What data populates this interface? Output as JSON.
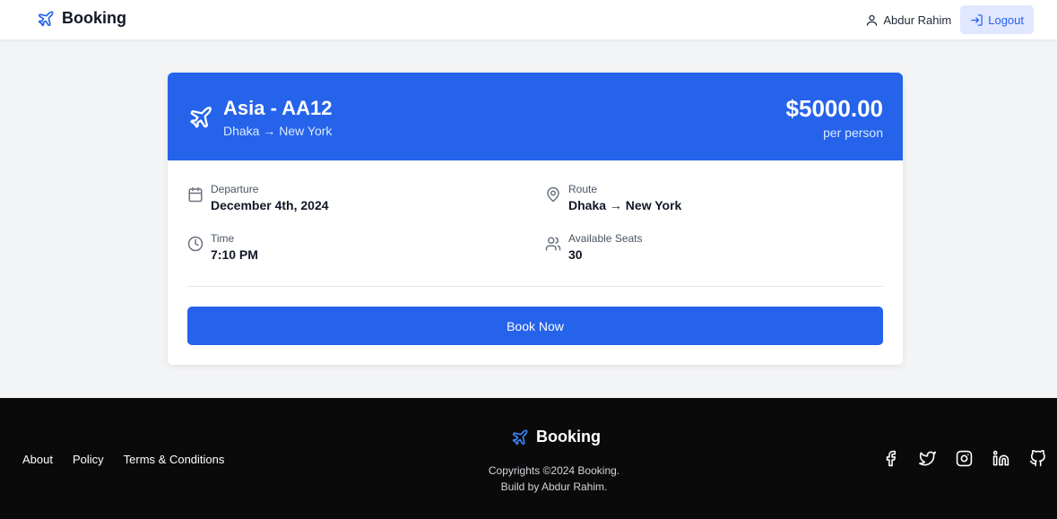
{
  "header": {
    "brand": "Booking",
    "user_name": "Abdur Rahim",
    "logout_label": "Logout"
  },
  "flight": {
    "title": "Asia - AA12",
    "route": "Dhaka → New York",
    "price": "$5000.00",
    "price_unit": "per person",
    "departure_label": "Departure",
    "departure_value": "December 4th, 2024",
    "route_label": "Route",
    "route_value": "Dhaka → New York",
    "time_label": "Time",
    "time_value": "7:10 PM",
    "seats_label": "Available Seats",
    "seats_value": "30",
    "book_label": "Book Now"
  },
  "footer": {
    "links": [
      "About",
      "Policy",
      "Terms & Conditions"
    ],
    "brand": "Booking",
    "copyright": "Copyrights ©2024 Booking.",
    "credit": "Build by Abdur Rahim.",
    "socials": [
      "facebook-icon",
      "twitter-icon",
      "instagram-icon",
      "linkedin-icon",
      "github-icon"
    ]
  },
  "colors": {
    "primary": "#2563eb",
    "footer_bg": "#0a0a0a",
    "page_bg": "#f3f4f6"
  }
}
